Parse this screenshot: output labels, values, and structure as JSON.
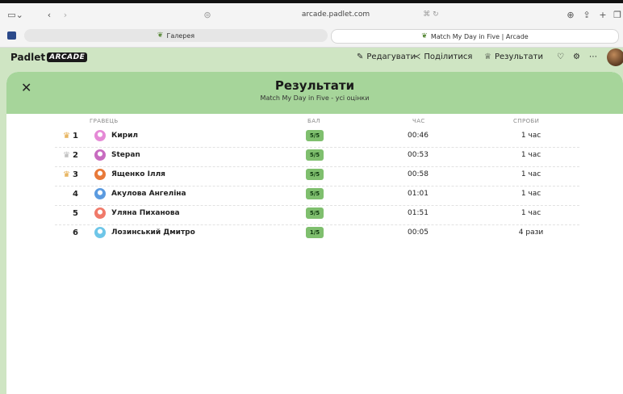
{
  "browser": {
    "url": "arcade.padlet.com",
    "tabs": [
      {
        "label": "Галерея"
      },
      {
        "label": "Match My Day in Five | Arcade"
      }
    ]
  },
  "app": {
    "logo_text": "Padlet",
    "logo_badge": "ARCADE",
    "actions": {
      "edit": "Редагувати",
      "share": "Поділитися",
      "results": "Результати"
    }
  },
  "results": {
    "title": "Результати",
    "subtitle": "Match My Day in Five - усі оцінки",
    "columns": {
      "player": "ГРАВЕЦЬ",
      "score": "БАЛ",
      "time": "ЧАС",
      "tries": "СПРОБИ"
    },
    "rows": [
      {
        "rank": "1",
        "name": "Кирил",
        "score": "5/5",
        "time": "00:46",
        "tries": "1 час",
        "avatar_color": "#e58ad6",
        "crown": "gold"
      },
      {
        "rank": "2",
        "name": "Stepan",
        "score": "5/5",
        "time": "00:53",
        "tries": "1 час",
        "avatar_color": "#c86cc0",
        "crown": "silver"
      },
      {
        "rank": "3",
        "name": "Ященко Ілля",
        "score": "5/5",
        "time": "00:58",
        "tries": "1 час",
        "avatar_color": "#e87a3a",
        "crown": "gold"
      },
      {
        "rank": "4",
        "name": "Акулова Ангеліна",
        "score": "5/5",
        "time": "01:01",
        "tries": "1 час",
        "avatar_color": "#5b9be0",
        "crown": ""
      },
      {
        "rank": "5",
        "name": "Уляна Пиханова",
        "score": "5/5",
        "time": "01:51",
        "tries": "1 час",
        "avatar_color": "#f07a6a",
        "crown": ""
      },
      {
        "rank": "6",
        "name": "Лозинський Дмитро",
        "score": "1/5",
        "time": "00:05",
        "tries": "4 рази",
        "avatar_color": "#6ec6e8",
        "crown": ""
      }
    ]
  },
  "colors": {
    "accent": "#a6d59a",
    "background": "#cfe5c3",
    "score_badge": "#7fbf6e"
  }
}
